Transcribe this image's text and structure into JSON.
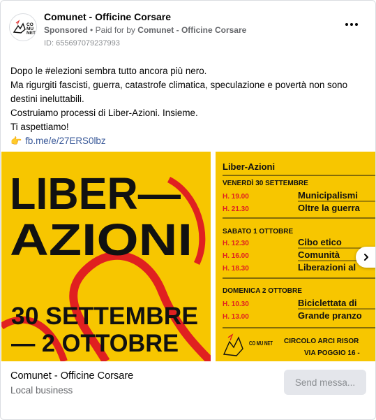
{
  "post": {
    "page_name": "Comunet - Officine Corsare",
    "sponsored_label": "Sponsored",
    "paid_for_prefix": "Paid for by",
    "paid_for_name": "Comunet - Officine Corsare",
    "ad_id": "ID: 655697079237993",
    "body_lines": [
      "Dopo le #elezioni sembra tutto ancora più nero.",
      "Ma rigurgiti fascisti, guerra, catastrofe climatica, speculazione e povertà non sono",
      "destini ineluttabili.",
      "Costruiamo processi di Liber-Azioni. Insieme.",
      "Ti aspettiamo!"
    ],
    "link_emoji": "👉",
    "link_text": "fb.me/e/27ERS0lbz"
  },
  "poster1": {
    "title_line1": "LIBER—",
    "title_line2": "AZIONI",
    "date_line1": "30 SETTEMBRE",
    "date_line2": "— 2 OTTOBRE"
  },
  "poster2": {
    "heading": "Liber-Azioni",
    "days": [
      {
        "day": "VENERDÌ 30 SETTEMBRE",
        "events": [
          {
            "time": "H. 19.00",
            "name": "Municipalismi"
          },
          {
            "time": "H. 21.30",
            "name": "Oltre la guerra"
          }
        ]
      },
      {
        "day": "SABATO 1 OTTOBRE",
        "events": [
          {
            "time": "H. 12.30",
            "name": "Cibo etico"
          },
          {
            "time": "H. 16.00",
            "name": "Comunità"
          },
          {
            "time": "H. 18.30",
            "name": "Liberazioni al"
          }
        ]
      },
      {
        "day": "DOMENICA 2 OTTOBRE",
        "events": [
          {
            "time": "H. 10.30",
            "name": "Biciclettata di"
          },
          {
            "time": "H. 13.00",
            "name": "Grande pranzo"
          }
        ]
      }
    ],
    "logo_text": "CO MU NET",
    "venue_line1": "CIRCOLO ARCI RISOR",
    "venue_line2": "VIA POGGIO 16 -"
  },
  "footer": {
    "name": "Comunet - Officine Corsare",
    "category": "Local business",
    "send_button": "Send messa..."
  },
  "icons": {
    "more": "more-options-icon",
    "next": "chevron-right-icon",
    "avatar": "comunet-logo"
  },
  "colors": {
    "poster_yellow": "#f7c600",
    "poster_red": "#e02020",
    "link_blue": "#385898"
  }
}
